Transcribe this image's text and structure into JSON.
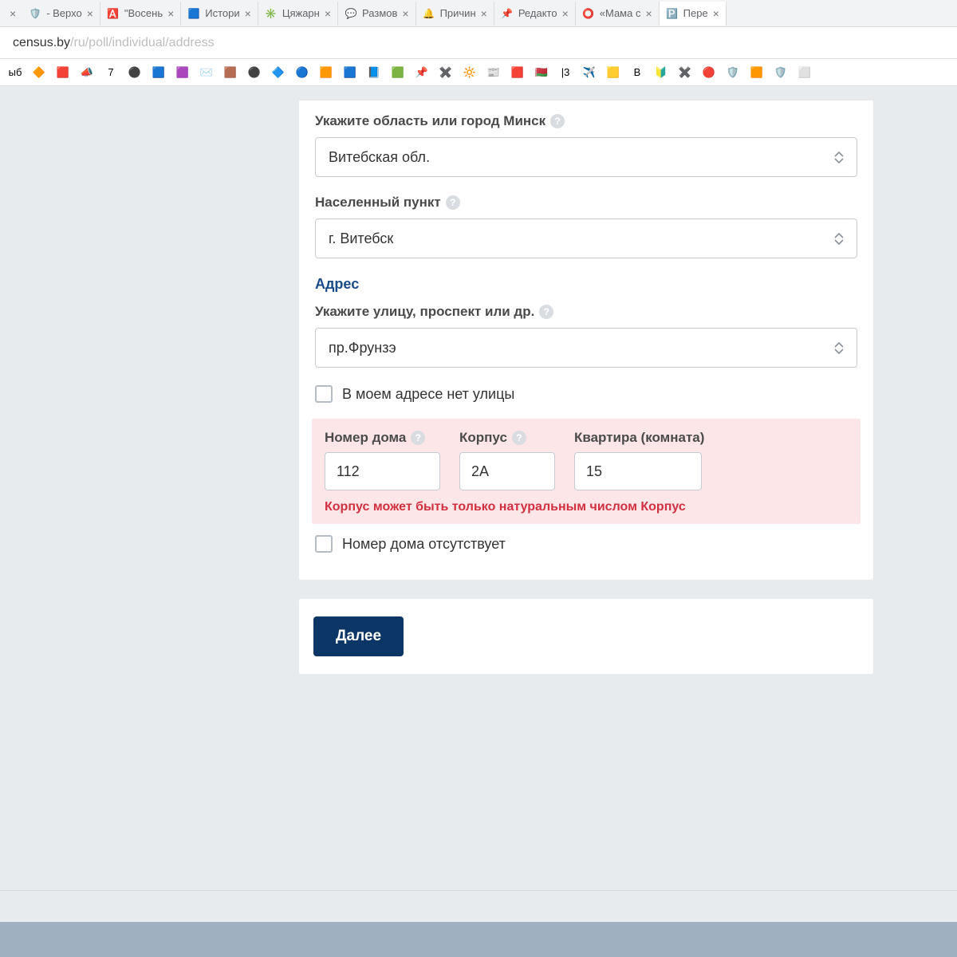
{
  "tabs": [
    {
      "icon": "🛡️",
      "label": "- Верхо"
    },
    {
      "icon": "🅰️",
      "label": "\"Восень"
    },
    {
      "icon": "🟦",
      "label": "Истори"
    },
    {
      "icon": "✳️",
      "label": "Цяжарн"
    },
    {
      "icon": "💬",
      "label": "Размов"
    },
    {
      "icon": "🔔",
      "label": "Причин"
    },
    {
      "icon": "📌",
      "label": "Редакто"
    },
    {
      "icon": "⭕",
      "label": "«Мама с"
    },
    {
      "icon": "🅿️",
      "label": "Пере",
      "active": true
    }
  ],
  "url": {
    "host": "census.by",
    "path": "/ru/poll/individual/address"
  },
  "bookmarks": [
    "ыб",
    "🔶",
    "🟥",
    "📣",
    "7",
    "⚫",
    "🟦",
    "🟪",
    "✉️",
    "🟫",
    "⚫",
    "🔷",
    "🔵",
    "🟧",
    "🟦",
    "📘",
    "🟩",
    "📌",
    "✖️",
    "🔆",
    "📰",
    "🟥",
    "🇧🇾",
    "|3",
    "✈️",
    "🟨",
    "B",
    "🔰",
    "✖️",
    "🔴",
    "🛡️",
    "🟧",
    "🛡️",
    "⬜"
  ],
  "form": {
    "region_label": "Укажите область или город Минск",
    "region_value": "Витебская обл.",
    "locality_label": "Населенный пункт",
    "locality_value": "г. Витебск",
    "address_section": "Адрес",
    "street_label": "Укажите улицу, проспект или др.",
    "street_value": "пр.Фрунзэ",
    "no_street_label": "В моем адресе нет улицы",
    "house_label": "Номер дома",
    "house_value": "112",
    "building_label": "Корпус",
    "building_value": "2А",
    "apartment_label": "Квартира (комната)",
    "apartment_value": "15",
    "error_msg": "Корпус может быть только натуральным числом",
    "error_field": "Корпус",
    "no_house_label": "Номер дома отсутствует",
    "next_button": "Далее"
  }
}
